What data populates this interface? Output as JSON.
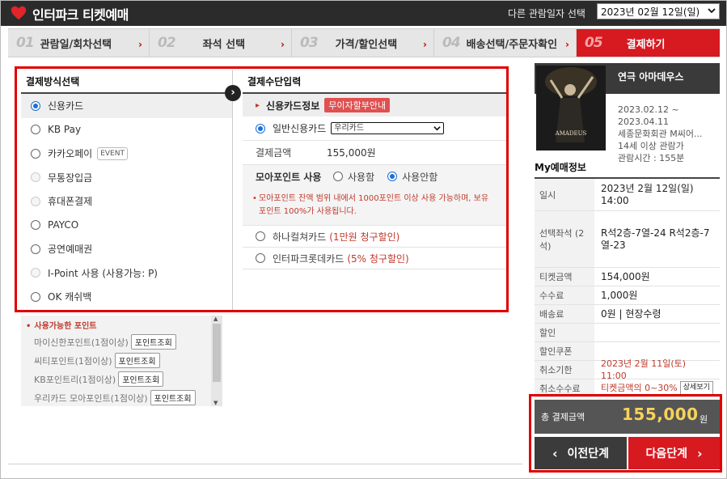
{
  "header": {
    "logo_text": "인터파크 티켓예매",
    "date_label": "다른 관람일자 선택",
    "date_value": "2023년 02월 12일(일)"
  },
  "steps": [
    {
      "num": "01",
      "label": "관람일/회차선택"
    },
    {
      "num": "02",
      "label": "좌석 선택"
    },
    {
      "num": "03",
      "label": "가격/할인선택"
    },
    {
      "num": "04",
      "label": "배송선택/주문자확인"
    },
    {
      "num": "05",
      "label": "결제하기"
    }
  ],
  "payment_methods": {
    "title": "결제방식선택",
    "items": [
      {
        "label": "신용카드"
      },
      {
        "label": "KB Pay"
      },
      {
        "label": "카카오페이",
        "badge": "EVENT"
      },
      {
        "label": "무통장입금"
      },
      {
        "label": "휴대폰결제"
      },
      {
        "label": "PAYCO"
      },
      {
        "label": "공연예매권"
      },
      {
        "label": "I-Point 사용 (사용가능: P)"
      },
      {
        "label": "OK 캐쉬백"
      }
    ]
  },
  "points": {
    "title": "사용가능한 포인트",
    "button_label": "포인트조회",
    "rows": [
      {
        "label": "마이신한포인트(1점이상)"
      },
      {
        "label": "씨티포인트(1점이상)"
      },
      {
        "label": "KB포인트리(1점이상)"
      },
      {
        "label": "우리카드 모아포인트(1점이상)"
      }
    ]
  },
  "payment_input": {
    "title": "결제수단입력",
    "card_info_label": "신용카드정보",
    "installment_button": "무이자할부안내",
    "general_card_label": "일반신용카드",
    "card_select_value": "우리카드",
    "amount_label": "결제금액",
    "amount_value": "155,000원",
    "moa_label": "모아포인트 사용",
    "moa_use": "사용함",
    "moa_nouse": "사용안함",
    "notice": "모아포인트 잔액 범위 내에서 1000포인트 이상 사용 가능하며, 보유 포인트 100%가 사용됩니다.",
    "discounts": [
      {
        "name": "하나컬쳐카드",
        "note": "(1만원 청구할인)"
      },
      {
        "name": "인터파크롯데카드",
        "note": "(5% 청구할인)"
      }
    ]
  },
  "show": {
    "title": "연극 아마데우스",
    "poster_text": "AMADEUS",
    "period_start": "2023.02.12 ~",
    "period_end": "2023.04.11",
    "venue": "세종문화회관 M씨어...",
    "age": "14세 이상 관람가",
    "runtime": "관람시간 : 155분"
  },
  "my_booking": {
    "title": "My예매정보",
    "rows": [
      {
        "key": "일시",
        "value": "2023년 2월 12일(일) 14:00"
      },
      {
        "key": "선택좌석 (2석)",
        "value": "R석2층-7열-24 R석2층-7열-23"
      },
      {
        "key": "티켓금액",
        "value": "154,000원"
      },
      {
        "key": "수수료",
        "value": "1,000원"
      },
      {
        "key": "배송료",
        "value": "0원 | 현장수령"
      },
      {
        "key": "할인",
        "value": ""
      },
      {
        "key": "할인쿠폰",
        "value": ""
      },
      {
        "key": "취소기한",
        "value": "2023년 2월 11일(토) 11:00"
      },
      {
        "key": "취소수수료",
        "value": "티켓금액의 0~30%",
        "button": "상세보기"
      }
    ]
  },
  "total": {
    "label": "총 결제금액",
    "amount": "155,000",
    "unit": "원"
  },
  "nav": {
    "prev": "이전단계",
    "next": "다음단계"
  },
  "colors": {
    "accent": "#d71920",
    "highlight_frame": "#e00000",
    "total_amount": "#f7d25b"
  }
}
